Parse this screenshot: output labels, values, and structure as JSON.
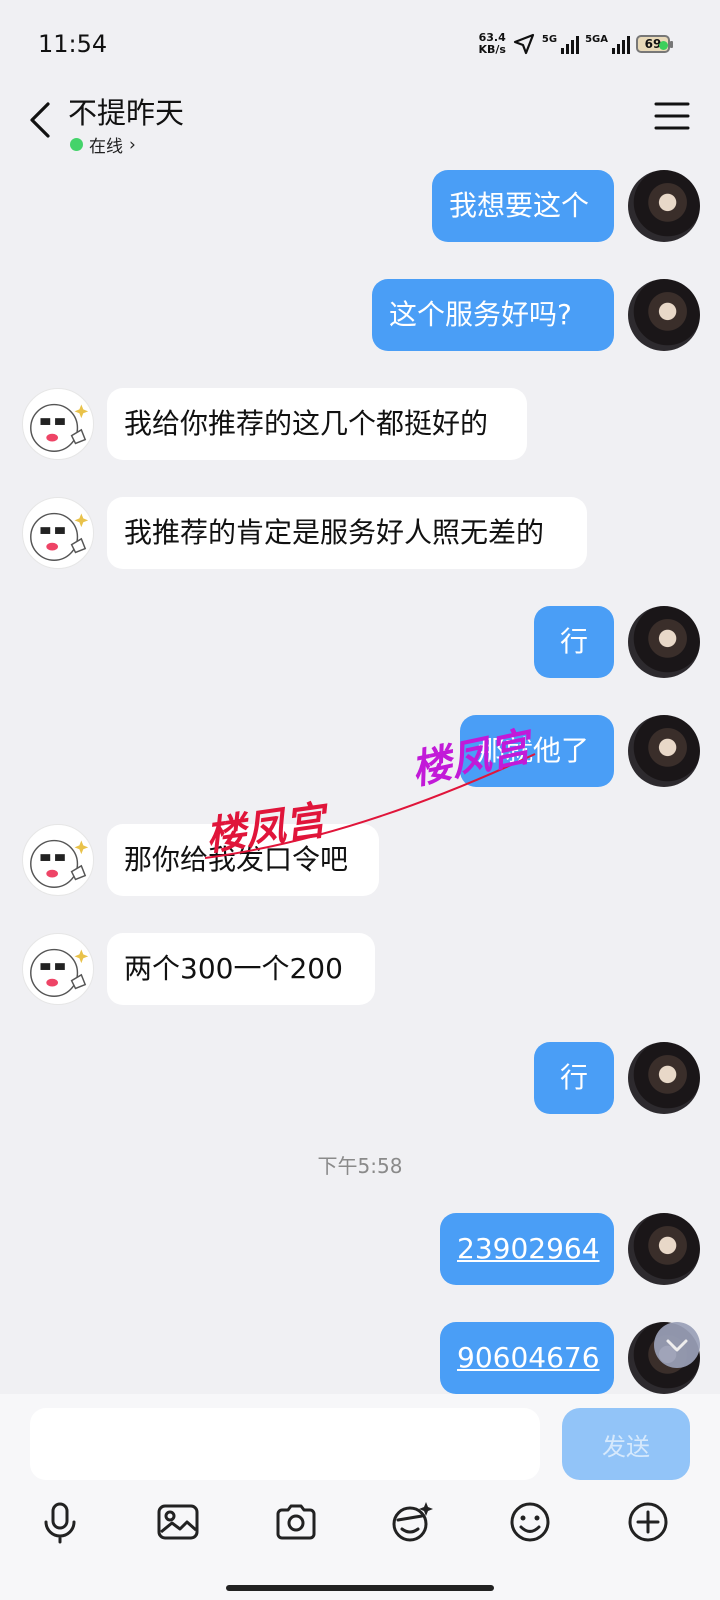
{
  "status_bar": {
    "time": "11:54",
    "net_speed_value": "63.4",
    "net_speed_unit": "KB/s",
    "signal1_label": "5G",
    "signal2_label": "5GA",
    "battery": "69"
  },
  "header": {
    "title": "不提昨天",
    "status": "在线",
    "status_chevron": "›"
  },
  "messages": [
    {
      "side": "out",
      "text": "我想要这个"
    },
    {
      "side": "out",
      "text": "这个服务好吗?"
    },
    {
      "side": "in",
      "text": "我给你推荐的这几个都挺好的"
    },
    {
      "side": "in",
      "text": "我推荐的肯定是服务好人照无差的"
    },
    {
      "side": "out",
      "text": "行"
    },
    {
      "side": "out",
      "text": "那就他了"
    },
    {
      "side": "in",
      "text": "那你给我发口令吧"
    },
    {
      "side": "in",
      "text": "两个300一个200"
    },
    {
      "side": "out",
      "text": "行"
    },
    {
      "side": "out",
      "text": "23902964"
    },
    {
      "side": "out",
      "text": "90604676"
    }
  ],
  "timestamp": "下午5:58",
  "watermark": "楼凤宫",
  "composer": {
    "placeholder": "",
    "send_label": "发送"
  },
  "colors": {
    "outgoing_bubble": "#4a9ef6",
    "incoming_bubble": "#ffffff",
    "background": "#f0f0f3",
    "send_button": "#92c4f8"
  },
  "icons": [
    "back-arrow-icon",
    "menu-icon",
    "microphone-icon",
    "image-icon",
    "camera-icon",
    "sticker-icon",
    "emoji-icon",
    "plus-icon",
    "chevron-down-icon"
  ]
}
